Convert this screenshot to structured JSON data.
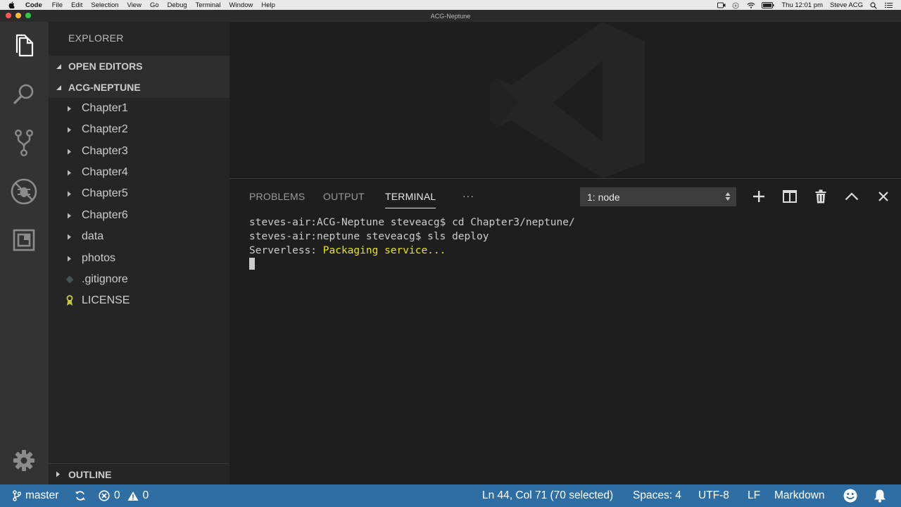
{
  "menubar": {
    "app": "Code",
    "items": [
      "File",
      "Edit",
      "Selection",
      "View",
      "Go",
      "Debug",
      "Terminal",
      "Window",
      "Help"
    ],
    "clock": "Thu 12:01 pm",
    "user": "Steve ACG"
  },
  "window": {
    "title": "ACG-Neptune"
  },
  "sidebar": {
    "title": "EXPLORER",
    "open_editors": "OPEN EDITORS",
    "project": "ACG-NEPTUNE",
    "folders": [
      "Chapter1",
      "Chapter2",
      "Chapter3",
      "Chapter4",
      "Chapter5",
      "Chapter6",
      "data",
      "photos"
    ],
    "files": [
      ".gitignore",
      "LICENSE"
    ],
    "outline": "OUTLINE"
  },
  "panel": {
    "tabs": [
      "PROBLEMS",
      "OUTPUT",
      "TERMINAL"
    ],
    "active_tab": "TERMINAL",
    "more": "···",
    "terminal_select": "1: node",
    "lines": {
      "l1": "steves-air:ACG-Neptune steveacg$ cd Chapter3/neptune/",
      "l2": "steves-air:neptune steveacg$ sls deploy",
      "l3_prefix": "Serverless: ",
      "l3_msg": "Packaging service..."
    }
  },
  "statusbar": {
    "branch": "master",
    "errors": "0",
    "warnings": "0",
    "position": "Ln 44, Col 71 (70 selected)",
    "spaces": "Spaces: 4",
    "encoding": "UTF-8",
    "eol": "LF",
    "language": "Markdown"
  },
  "colors": {
    "statusbar": "#2f6ea3",
    "terminal_highlight": "#e5e510",
    "activitybar": "#333333",
    "sidebar": "#252526"
  }
}
